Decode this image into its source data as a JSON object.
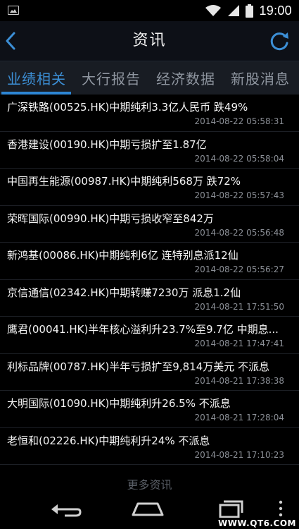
{
  "status_bar": {
    "time": "19:00",
    "icons": [
      "image-notification-icon",
      "wifi-icon",
      "signal-icon",
      "battery-icon"
    ]
  },
  "header": {
    "title": "资讯",
    "back_icon": "chevron-left-icon",
    "refresh_icon": "refresh-icon",
    "accent_color": "#3c8fd6"
  },
  "tabs": [
    {
      "label": "业绩相关",
      "active": true
    },
    {
      "label": "大行报告",
      "active": false
    },
    {
      "label": "经济数据",
      "active": false
    },
    {
      "label": "新股消息",
      "active": false
    }
  ],
  "news": [
    {
      "title": "广深铁路(00525.HK)中期纯利3.3亿人民币 跌49%",
      "time": "2014-08-22 05:58:31"
    },
    {
      "title": "香港建设(00190.HK)中期亏损扩至1.87亿",
      "time": "2014-08-22 05:58:04"
    },
    {
      "title": "中国再生能源(00987.HK)中期纯利568万 跌72%",
      "time": "2014-08-22 05:57:43"
    },
    {
      "title": "荣晖国际(00990.HK)中期亏损收窄至842万",
      "time": "2014-08-22 05:56:48"
    },
    {
      "title": "新鸿基(00086.HK)中期纯利6亿 连特别息派12仙",
      "time": "2014-08-22 05:56:27"
    },
    {
      "title": "京信通信(02342.HK)中期转赚7230万 派息1.2仙",
      "time": "2014-08-21 17:51:50"
    },
    {
      "title": "鹰君(00041.HK)半年核心溢利升23.7%至9.7亿 中期息...",
      "time": "2014-08-21 17:47:41"
    },
    {
      "title": "利标品牌(00787.HK)半年亏损扩至9,814万美元 不派息",
      "time": "2014-08-21 17:38:38"
    },
    {
      "title": "大明国际(01090.HK)中期纯利升26.5% 不派息",
      "time": "2014-08-21 17:28:04"
    },
    {
      "title": "老恒和(02226.HK)中期纯利升24% 不派息",
      "time": "2014-08-21 17:10:23"
    }
  ],
  "more_label": "更多资讯",
  "nav_bar": {
    "icons": [
      "back-nav-icon",
      "home-nav-icon",
      "recent-apps-icon",
      "overflow-menu-icon"
    ]
  },
  "watermark": "WWW.QT6.COM"
}
